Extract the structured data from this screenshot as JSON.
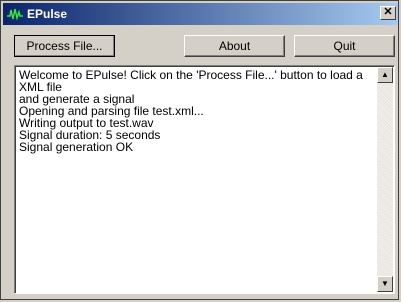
{
  "window": {
    "title": "EPulse"
  },
  "toolbar": {
    "process_label": "Process File...",
    "about_label": "About",
    "quit_label": "Quit"
  },
  "log": {
    "text": "Welcome to EPulse! Click on the 'Process File...' button to load a XML file\nand generate a signal\nOpening and parsing file test.xml...\nWriting output to test.wav\nSignal duration: 5 seconds\nSignal generation OK"
  },
  "icons": {
    "app": "pulse-icon",
    "close": "close-icon",
    "scroll_up": "arrow-up-icon",
    "scroll_down": "arrow-down-icon"
  },
  "colors": {
    "titlebar_start": "#0a246a",
    "titlebar_end": "#a6caf0",
    "face": "#d4d0c8"
  }
}
